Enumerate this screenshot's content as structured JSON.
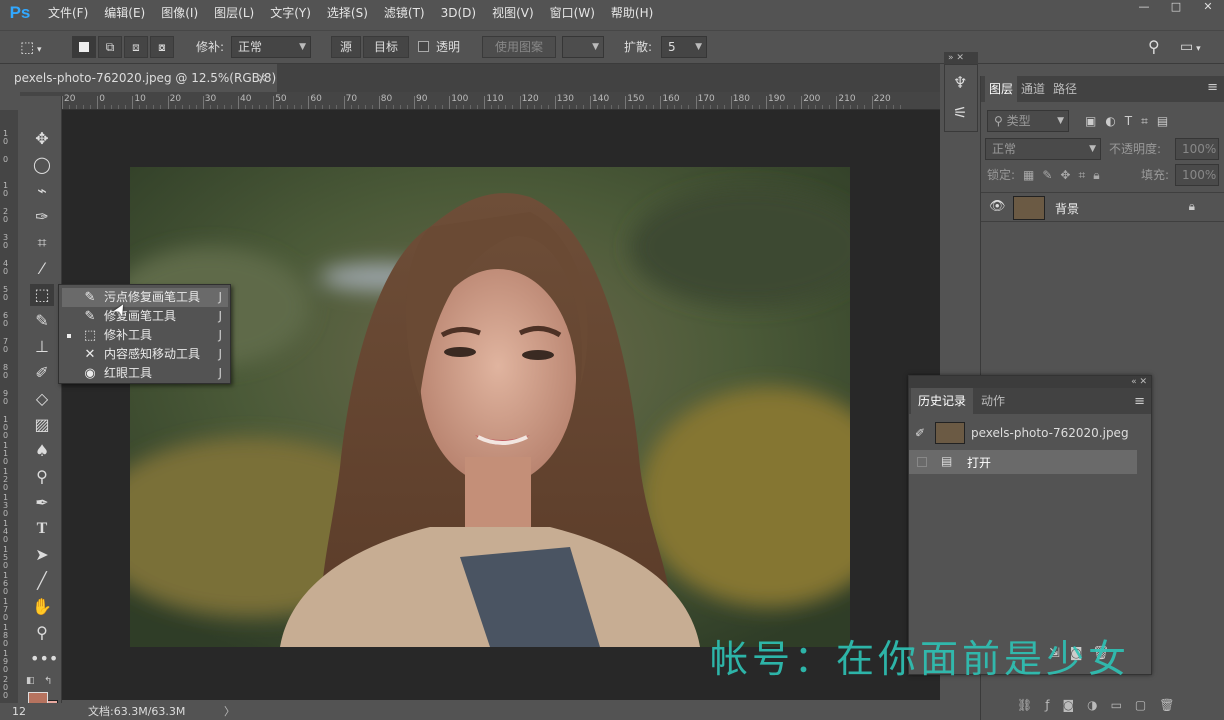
{
  "app": {
    "logo": "Ps"
  },
  "menu": [
    "文件(F)",
    "编辑(E)",
    "图像(I)",
    "图层(L)",
    "文字(Y)",
    "选择(S)",
    "滤镜(T)",
    "3D(D)",
    "视图(V)",
    "窗口(W)",
    "帮助(H)"
  ],
  "window_controls": {
    "minimize": "—",
    "maximize": "□",
    "close": "✕"
  },
  "options": {
    "patch_label": "修补:",
    "patch_mode": "正常",
    "source_btn": "源",
    "target_btn": "目标",
    "transparent_label": "透明",
    "use_pattern_btn": "使用图案",
    "diffusion_label": "扩散:",
    "diffusion_value": "5"
  },
  "document": {
    "tab_title": "pexels-photo-762020.jpeg @ 12.5%(RGB/8)",
    "tab_close": "×",
    "status": "文档:63.3M/63.3M",
    "zoom": "12"
  },
  "ruler": {
    "h_ticks": [
      "20",
      "0",
      "10",
      "20",
      "30",
      "40",
      "50",
      "60",
      "70",
      "80",
      "90",
      "100",
      "110",
      "120",
      "130",
      "140",
      "150",
      "160",
      "170",
      "180",
      "190",
      "200",
      "210",
      "220"
    ],
    "v_ticks": [
      "1\n0",
      "0",
      "1\n0",
      "2\n0",
      "3\n0",
      "4\n0",
      "5\n0",
      "6\n0",
      "7\n0",
      "8\n0",
      "9\n0",
      "1\n0\n0",
      "1\n1\n0",
      "1\n2\n0",
      "1\n3\n0",
      "1\n4\n0",
      "1\n5\n0",
      "1\n6\n0",
      "1\n7\n0",
      "1\n8\n0",
      "1\n9\n0",
      "2\n0\n0"
    ]
  },
  "flyout": {
    "items": [
      {
        "label": "污点修复画笔工具",
        "key": "J",
        "icon": "✎",
        "highlighted": true,
        "active": false
      },
      {
        "label": "修复画笔工具",
        "key": "J",
        "icon": "✎",
        "highlighted": false,
        "active": false
      },
      {
        "label": "修补工具",
        "key": "J",
        "icon": "⬚",
        "highlighted": false,
        "active": true
      },
      {
        "label": "内容感知移动工具",
        "key": "J",
        "icon": "✕",
        "highlighted": false,
        "active": false
      },
      {
        "label": "红眼工具",
        "key": "J",
        "icon": "◉",
        "highlighted": false,
        "active": false
      }
    ]
  },
  "layers_panel": {
    "tabs": [
      "图层",
      "通道",
      "路径"
    ],
    "filter_kind": "类型",
    "blend_mode": "正常",
    "opacity_label": "不透明度:",
    "opacity_value": "100%",
    "lock_label": "锁定:",
    "fill_label": "填充:",
    "fill_value": "100%",
    "layer_name": "背景"
  },
  "history_panel": {
    "tabs": [
      "历史记录",
      "动作"
    ],
    "snapshot": "pexels-photo-762020.jpeg",
    "steps": [
      "打开"
    ]
  },
  "watermark": "帐号：在你面前是少女",
  "colors": {
    "accent": "#31a8ff",
    "foreground": "#b6735f",
    "background": "#e8a9a0",
    "watermark": "#2ec4b6"
  }
}
